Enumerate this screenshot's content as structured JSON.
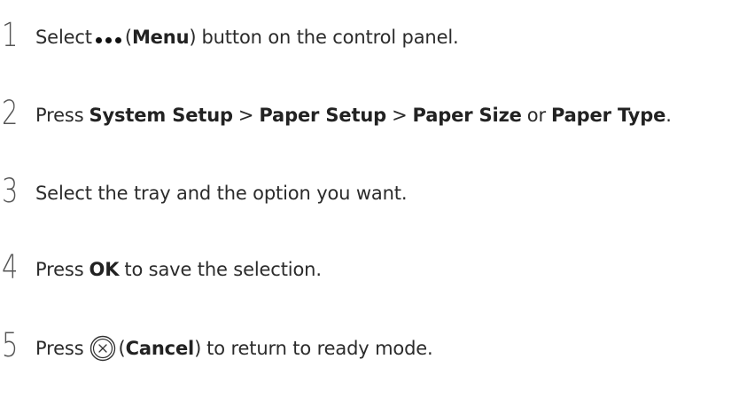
{
  "steps": [
    {
      "number": "1",
      "text_a": "Select",
      "menu_label": "Menu",
      "text_b": "button on the control panel.",
      "open_paren": "(",
      "close_paren": ")"
    },
    {
      "number": "2",
      "text_a": "Press",
      "item_1": "System Setup",
      "sep_1": ">",
      "item_2": "Paper Setup",
      "sep_2": ">",
      "item_3": "Paper Size",
      "or": "or",
      "item_4": "Paper Type",
      "end": "."
    },
    {
      "number": "3",
      "text": "Select the tray and the option you want."
    },
    {
      "number": "4",
      "text_a": "Press",
      "ok_label": "OK",
      "text_b": "to save the selection."
    },
    {
      "number": "5",
      "text_a": "Press",
      "cancel_label": "Cancel",
      "text_b": "to return to ready mode.",
      "open_paren": "(",
      "close_paren": ")"
    }
  ],
  "icons": {
    "menu": "more-dots-icon",
    "cancel": "cancel-circle-x-icon"
  }
}
